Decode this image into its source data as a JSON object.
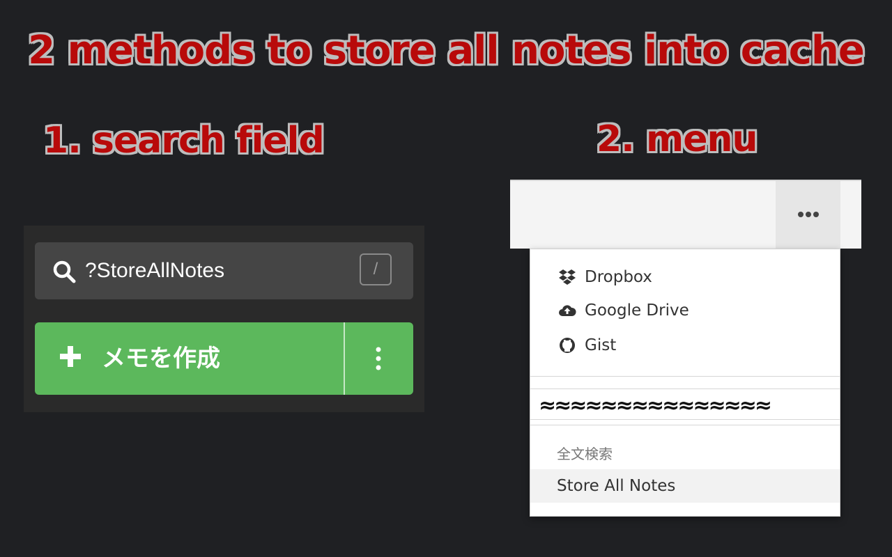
{
  "title": "2 methods to store all notes into cache",
  "method1": {
    "heading": "1. search field",
    "search": {
      "value": "?StoreAllNotes",
      "shortcut_key": "/"
    },
    "create_button": {
      "label": "メモを作成"
    }
  },
  "method2": {
    "heading": "2. menu",
    "menu": {
      "items": [
        {
          "label": "Dropbox",
          "icon": "dropbox-icon"
        },
        {
          "label": "Google Drive",
          "icon": "cloud-upload-icon"
        },
        {
          "label": "Gist",
          "icon": "github-icon"
        }
      ],
      "tear_marks": "≈≈≈≈≈≈≈≈≈≈≈≈≈≈≈",
      "section_header": "全文検索",
      "store_all_notes": "Store All Notes"
    }
  },
  "colors": {
    "background": "#1f2023",
    "headline_text": "#b80a0a",
    "headline_outline": "#bdbdbd",
    "create_button": "#5cb85c",
    "search_box": "#454545"
  }
}
